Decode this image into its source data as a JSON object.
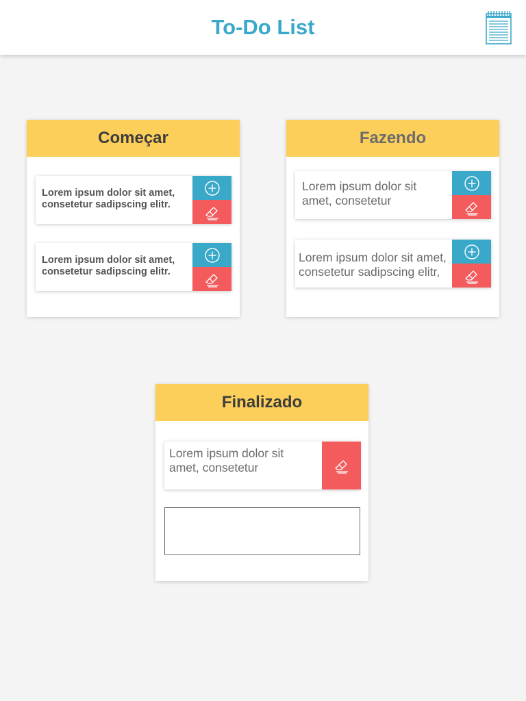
{
  "header": {
    "title": "To-Do List",
    "icon": "notepad-icon",
    "accent_color": "#3aa8c8"
  },
  "colors": {
    "column_header": "#fbcf5a",
    "add_button": "#3aa8c8",
    "delete_button": "#f35b5d",
    "background": "#f4f4f4"
  },
  "columns": [
    {
      "title": "Começar",
      "cards": [
        {
          "text": "Lorem ipsum dolor sit amet, consetetur sadipscing elitr.",
          "actions": [
            "add-icon",
            "eraser-icon"
          ]
        },
        {
          "text": "Lorem ipsum dolor sit amet, consetetur sadipscing elitr.",
          "actions": [
            "add-icon",
            "eraser-icon"
          ]
        }
      ]
    },
    {
      "title": "Fazendo",
      "cards": [
        {
          "text": "Lorem ipsum dolor sit amet, consetetur",
          "actions": [
            "add-icon",
            "eraser-icon"
          ]
        },
        {
          "text": "Lorem ipsum dolor sit amet, consetetur sadipscing elitr,",
          "actions": [
            "add-icon",
            "eraser-icon"
          ]
        }
      ]
    },
    {
      "title": "Finalizado",
      "cards": [
        {
          "text": "Lorem ipsum dolor sit amet, consetetur",
          "actions": [
            "eraser-icon"
          ]
        }
      ],
      "new_task_input": {
        "value": "",
        "placeholder": ""
      }
    }
  ]
}
